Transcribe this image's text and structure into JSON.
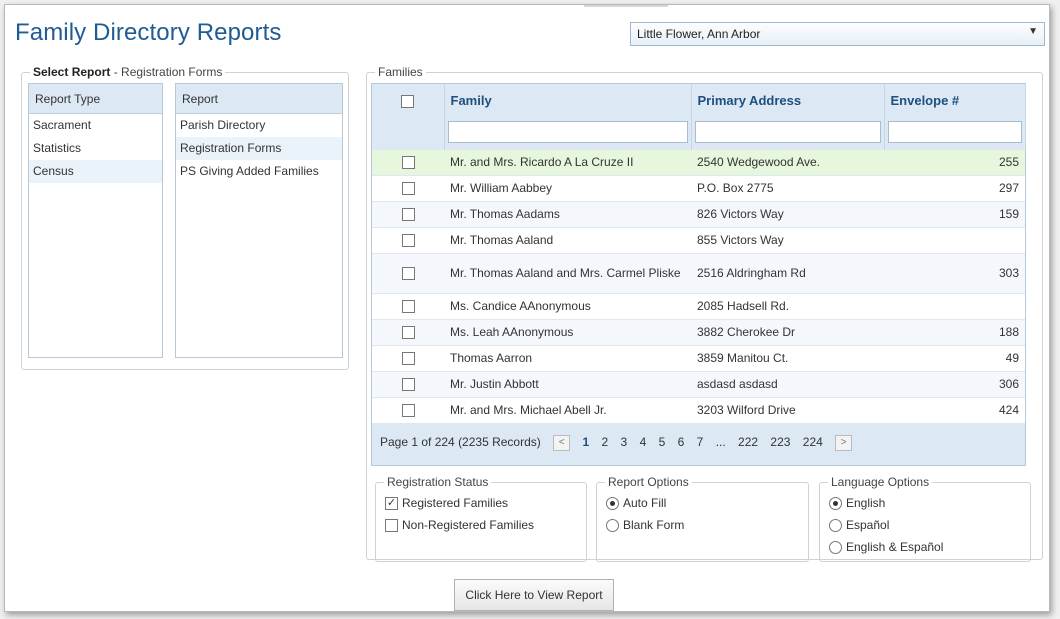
{
  "page_title": "Family Directory Reports",
  "parish_select": {
    "value": "Little Flower, Ann Arbor"
  },
  "select_report": {
    "legend_bold": "Select Report",
    "legend_rest": " - Registration Forms",
    "report_type": {
      "header": "Report Type",
      "items": [
        "Sacrament",
        "Statistics",
        "Census"
      ]
    },
    "report": {
      "header": "Report",
      "items": [
        "Parish Directory",
        "Registration Forms",
        "PS Giving Added Families"
      ]
    }
  },
  "families": {
    "legend": "Families",
    "columns": [
      "Family",
      "Primary Address",
      "Envelope #"
    ],
    "rows": [
      {
        "family": "Mr. and Mrs. Ricardo A La Cruze II",
        "address": "2540 Wedgewood Ave.",
        "envelope": "255"
      },
      {
        "family": "Mr. William Aabbey",
        "address": "P.O. Box 2775",
        "envelope": "297"
      },
      {
        "family": "Mr. Thomas Aadams",
        "address": "826 Victors Way",
        "envelope": "159"
      },
      {
        "family": "Mr. Thomas Aaland",
        "address": "855 Victors Way",
        "envelope": ""
      },
      {
        "family": "Mr. Thomas Aaland and Mrs. Carmel Pliske",
        "address": "2516 Aldringham Rd",
        "envelope": "303"
      },
      {
        "family": "Ms. Candice AAnonymous",
        "address": "2085 Hadsell Rd.",
        "envelope": ""
      },
      {
        "family": "Ms. Leah AAnonymous",
        "address": "3882 Cherokee Dr",
        "envelope": "188"
      },
      {
        "family": "Thomas Aarron",
        "address": "3859 Manitou Ct.",
        "envelope": "49"
      },
      {
        "family": "Mr. Justin Abbott",
        "address": "asdasd asdasd",
        "envelope": "306"
      },
      {
        "family": "Mr. and Mrs. Michael Abell Jr.",
        "address": "3203 Wilford Drive",
        "envelope": "424"
      }
    ],
    "pager": {
      "summary": "Page 1 of 224 (2235 Records)",
      "prev": "<",
      "pages": [
        "1",
        "2",
        "3",
        "4",
        "5",
        "6",
        "7",
        "...",
        "222",
        "223",
        "224"
      ],
      "next": ">"
    }
  },
  "registration_status": {
    "legend": "Registration Status",
    "options": [
      {
        "label": "Registered Families",
        "checked": true
      },
      {
        "label": "Non-Registered Families",
        "checked": false
      }
    ]
  },
  "report_options": {
    "legend": "Report Options",
    "options": [
      {
        "label": "Auto Fill",
        "selected": true
      },
      {
        "label": "Blank Form",
        "selected": false
      }
    ]
  },
  "language_options": {
    "legend": "Language Options",
    "options": [
      {
        "label": "English",
        "selected": true
      },
      {
        "label": "Español",
        "selected": false
      },
      {
        "label": "English & Español",
        "selected": false
      }
    ]
  },
  "view_button": "Click Here to View Report",
  "colors": {
    "title": "#1f5c94",
    "header_bg": "#dce8f4",
    "highlight_row": "#e6f7dd"
  }
}
